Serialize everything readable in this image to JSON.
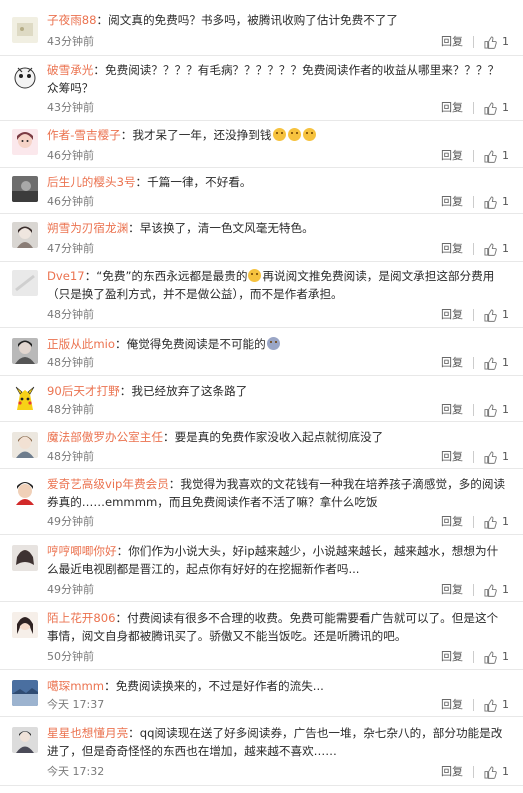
{
  "comments": [
    {
      "user": "子夜雨88",
      "text": "阅文真的免费吗？书多吗，被腾讯收购了估计免费不了了",
      "time": "43分钟前",
      "likes": "1"
    },
    {
      "user": "破雪承光",
      "text": "免费阅读？？？？有毛病？？？？？？免费阅读作者的收益从哪里来？？？？众筹吗？",
      "time": "43分钟前",
      "likes": "1"
    },
    {
      "user": "作者-雪吉樱子",
      "text": "我才呆了一年，还没挣到钱",
      "emojis": 3,
      "time": "46分钟前",
      "likes": "1"
    },
    {
      "user": "后生儿的樱头3号",
      "text": "千篇一律，不好看。",
      "time": "46分钟前",
      "likes": "1"
    },
    {
      "user": "朔雪为刃宿龙渊",
      "text": "早该换了，清一色文风毫无特色。",
      "time": "47分钟前",
      "likes": "1"
    },
    {
      "user": "Dve17",
      "text_a": "“免费”的东西永远都是最贵的",
      "text_b": "再说阅文推免费阅读，是阅文承担这部分费用（只是换了盈利方式，并不是做公益），而不是作者承担。",
      "time": "48分钟前",
      "likes": "1"
    },
    {
      "user": "正版从此mio",
      "text": "俺觉得免费阅读是不可能的",
      "emojis_sad": 1,
      "time": "48分钟前",
      "likes": "1"
    },
    {
      "user": "90后天才打野",
      "text": "我已经放弃了这条路了",
      "time": "48分钟前",
      "likes": "1"
    },
    {
      "user": "魔法部傲罗办公室主任",
      "text": "要是真的免费作家没收入起点就彻底没了",
      "time": "48分钟前",
      "likes": "1"
    },
    {
      "user": "爱奇艺高级vip年费会员",
      "text": "我觉得为我喜欢的文花钱有一种我在培养孩子滴感觉，多的阅读券真的……emmmm，而且免费阅读作者不活了嘛？拿什么吃饭",
      "time": "49分钟前",
      "likes": "1"
    },
    {
      "user": "哼哼唧唧你好",
      "text": "你们作为小说大头，好ip越来越少，小说越来越长，越来越水，想想为什么最近电视剧都是晋江的，起点你有好好的在挖掘新作者吗...",
      "time": "49分钟前",
      "likes": "1"
    },
    {
      "user": "陌上花开806",
      "text": "付费阅读有很多不合理的收费。免费可能需要看广告就可以了。但是这个事情，阅文自身都被腾讯买了。骄傲又不能当饭吃。还是听腾讯的吧。",
      "time": "50分钟前",
      "likes": "1"
    },
    {
      "user": "噶琛mmm",
      "text": "免费阅读换来的，不过是好作者的流失...",
      "time": "今天 17:37",
      "likes": "1"
    },
    {
      "user": "星星也想懂月亮",
      "text": "qq阅读现在送了好多阅读券，广告也一堆，杂七杂八的，部分功能是改进了，但是奇奇怪怪的东西也在增加，越来越不喜欢……",
      "time": "今天 17:32",
      "likes": "1"
    }
  ],
  "labels": {
    "reply": "回复"
  },
  "colors": {
    "username": "#eb7350",
    "divider": "#e8e8e8"
  }
}
